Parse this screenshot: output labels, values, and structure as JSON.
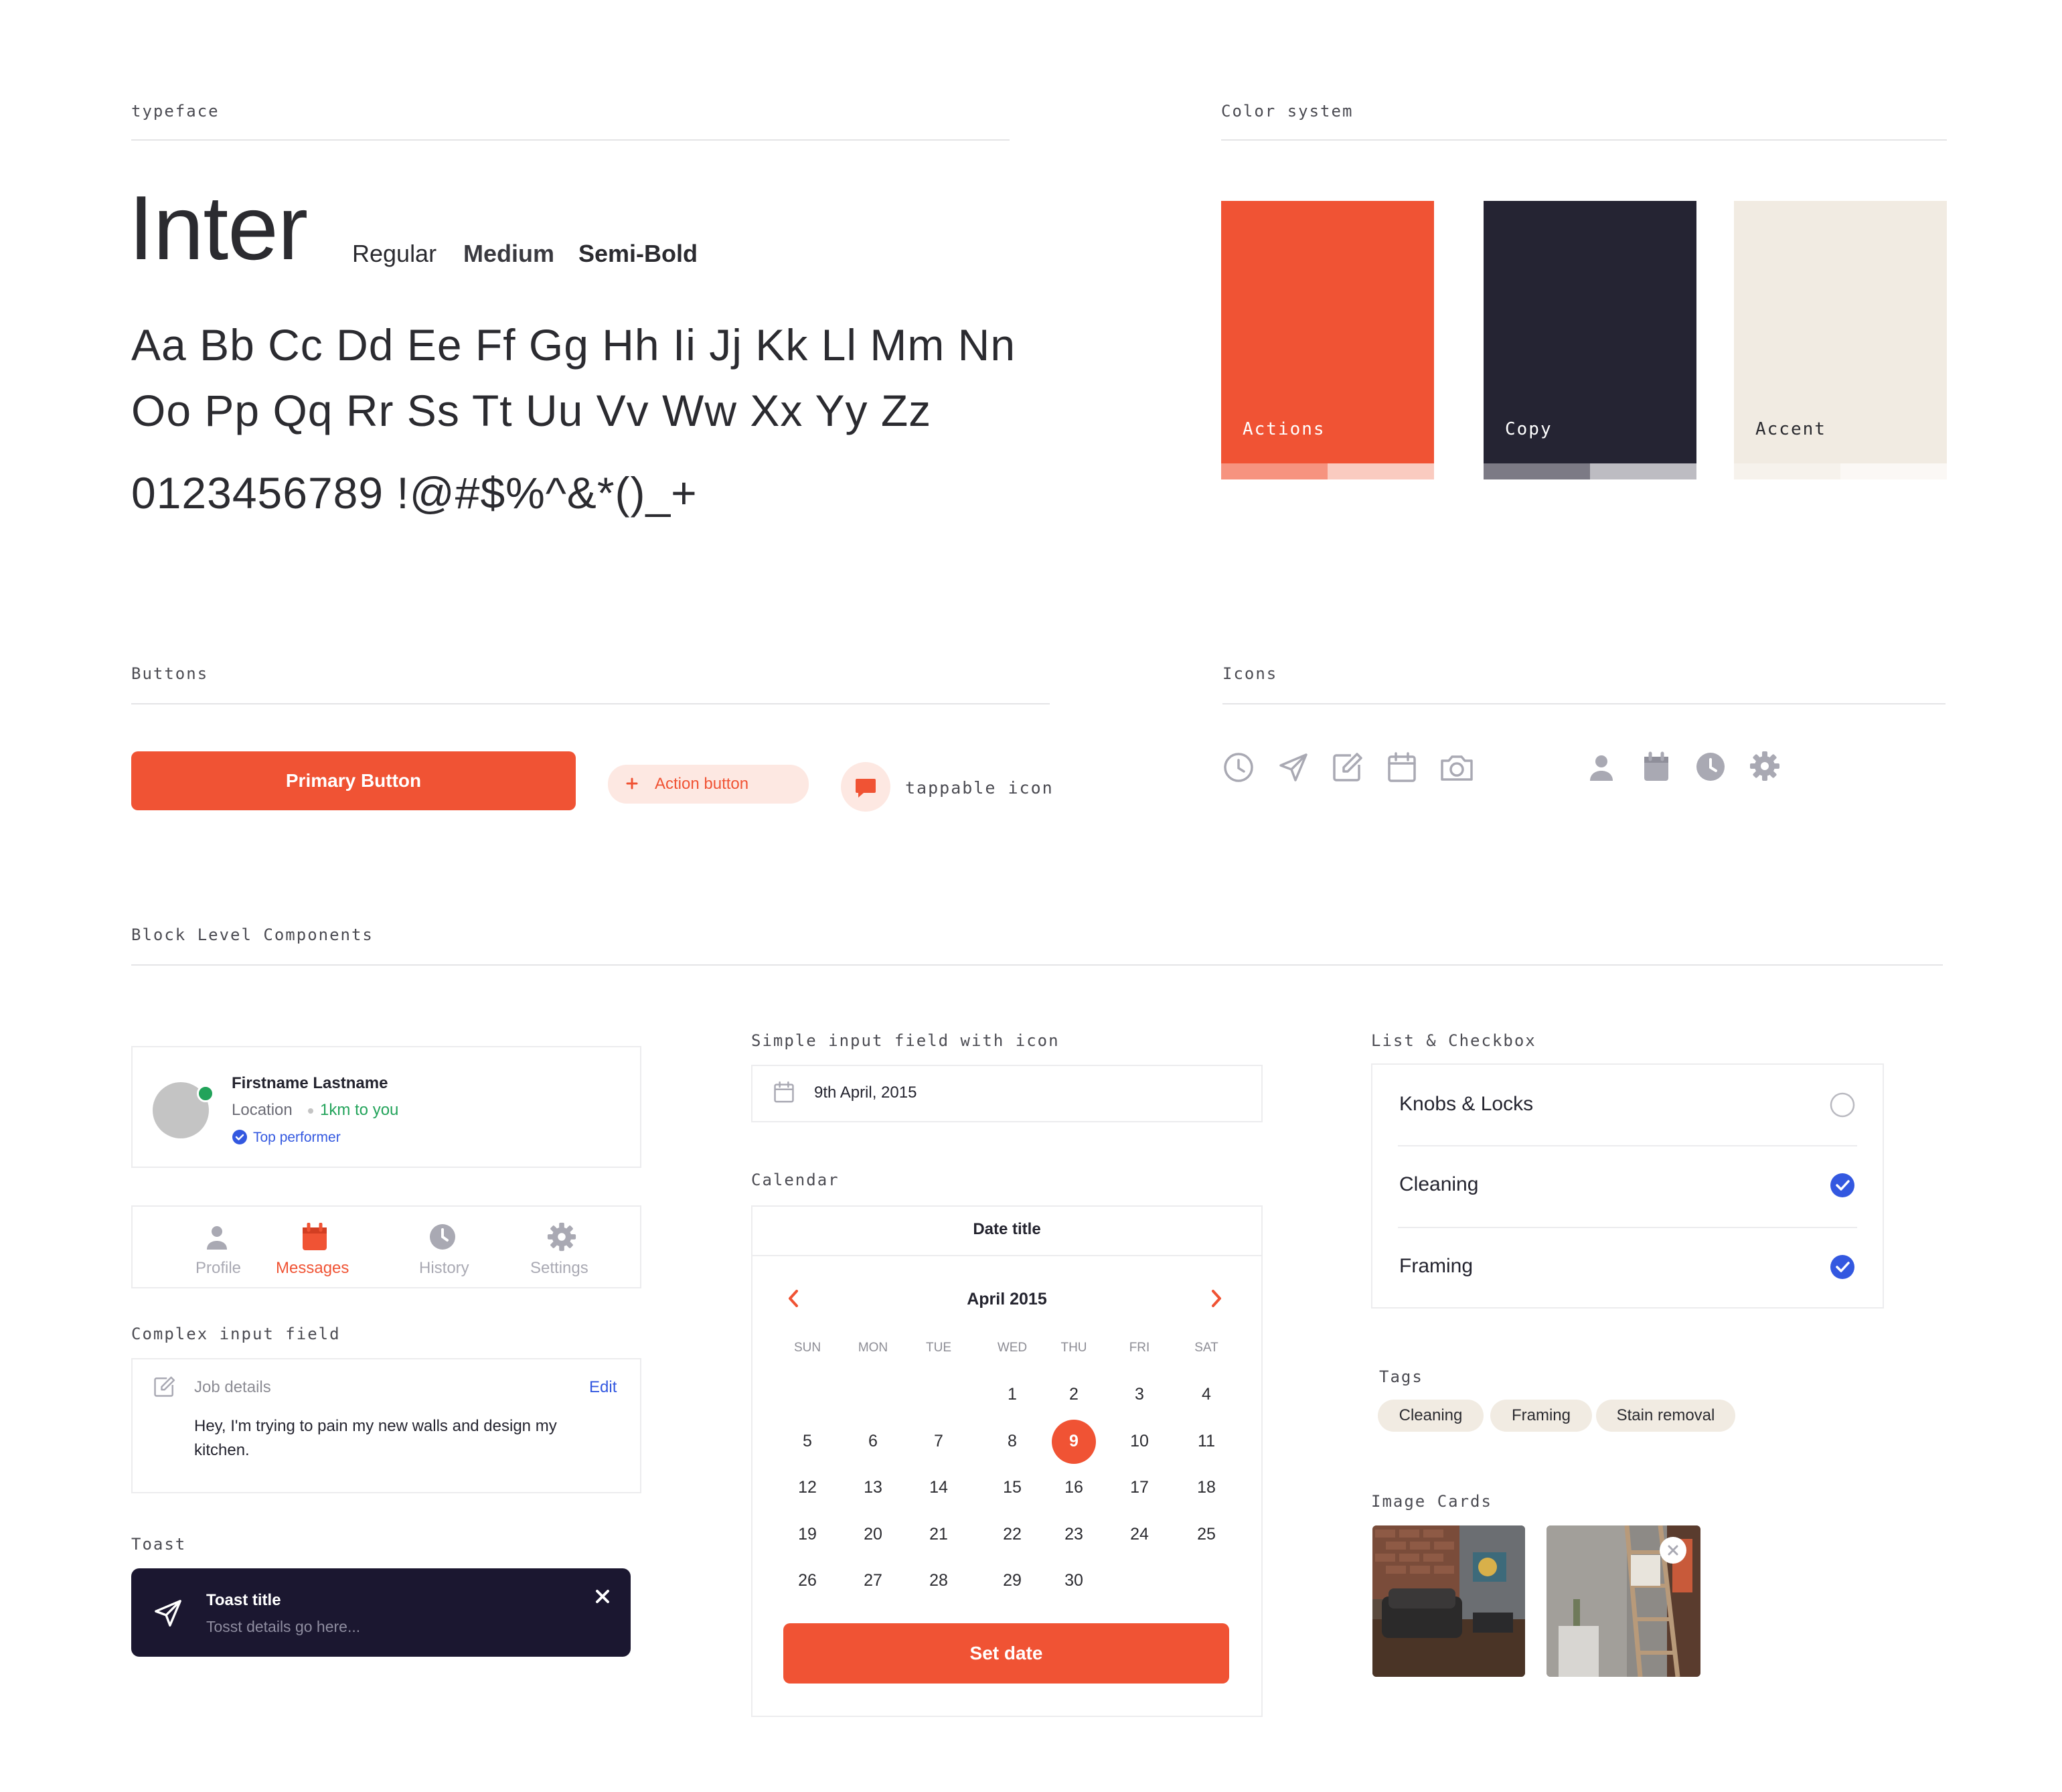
{
  "typeface": {
    "section_label": "typeface",
    "family": "Inter",
    "weights": [
      "Regular",
      "Medium",
      "Semi-Bold"
    ],
    "alphabet_line1": "Aa Bb Cc Dd Ee Ff Gg Hh Ii Jj Kk Ll Mm Nn",
    "alphabet_line2": "Oo Pp Qq Rr Ss Tt Uu Vv Ww Xx Yy Zz",
    "numerals": "0123456789 !@#$%^&*()_+"
  },
  "colors": {
    "section_label": "Color system",
    "swatches": [
      {
        "label": "Actions",
        "color": "#f05334",
        "tint1": "#f6937f",
        "tint2": "#facbc0"
      },
      {
        "label": "Copy",
        "color": "#252433",
        "tint1": "#7c7a85",
        "tint2": "#bdbcc2"
      },
      {
        "label": "Accent",
        "color": "#f1ebe2",
        "tint1": "#f6f2ec",
        "tint2": "#fbf8f5"
      }
    ]
  },
  "buttons": {
    "section_label": "Buttons",
    "primary_label": "Primary Button",
    "action_label": "Action button",
    "action_icon": "plus-icon",
    "tappable_label": "tappable icon",
    "tappable_icon": "chat-bubble-icon"
  },
  "icons": {
    "section_label": "Icons",
    "outline": [
      "clock-icon",
      "send-icon",
      "edit-icon",
      "calendar-icon",
      "camera-icon"
    ],
    "filled": [
      "user-icon",
      "calendar-filled-icon",
      "clock-filled-icon",
      "gear-icon"
    ]
  },
  "blocks": {
    "section_label": "Block Level Components",
    "profile": {
      "name": "Firstname Lastname",
      "location": "Location",
      "distance": "1km to you",
      "badge": "Top performer"
    },
    "tabbar": {
      "tabs": [
        {
          "label": "Profile",
          "icon": "user-icon",
          "active": false
        },
        {
          "label": "Messages",
          "icon": "calendar-icon",
          "active": true
        },
        {
          "label": "History",
          "icon": "clock-icon",
          "active": false
        },
        {
          "label": "Settings",
          "icon": "gear-icon",
          "active": false
        }
      ],
      "active_color": "#f05334",
      "inactive_color": "#a9a9b3"
    },
    "complex_input": {
      "label": "Complex input field",
      "title": "Job details",
      "edit": "Edit",
      "body_line1": "Hey, I'm trying to pain my new walls and design my",
      "body_line2": "kitchen."
    },
    "toast": {
      "label": "Toast",
      "title": "Toast title",
      "details": "Tosst details go here..."
    },
    "simple_input": {
      "label": "Simple input field with icon",
      "value": "9th April, 2015"
    },
    "calendar": {
      "label": "Calendar",
      "header": "Date title",
      "month": "April 2015",
      "weekdays": [
        "SUN",
        "MON",
        "TUE",
        "WED",
        "THU",
        "FRI",
        "SAT"
      ],
      "weeks": [
        [
          "",
          "",
          "",
          "1",
          "2",
          "3",
          "4"
        ],
        [
          "5",
          "6",
          "7",
          "8",
          "9",
          "10",
          "11"
        ],
        [
          "12",
          "13",
          "14",
          "15",
          "16",
          "17",
          "18"
        ],
        [
          "19",
          "20",
          "21",
          "22",
          "23",
          "24",
          "25"
        ],
        [
          "26",
          "27",
          "28",
          "29",
          "30",
          "",
          ""
        ]
      ],
      "selected": "9",
      "button": "Set date"
    },
    "list": {
      "label": "List & Checkbox",
      "items": [
        {
          "text": "Knobs & Locks",
          "checked": false
        },
        {
          "text": "Cleaning",
          "checked": true
        },
        {
          "text": "Framing",
          "checked": true
        }
      ]
    },
    "tags": {
      "label": "Tags",
      "items": [
        "Cleaning",
        "Framing",
        "Stain removal"
      ]
    },
    "image_cards": {
      "label": "Image Cards",
      "close_icon": "close-icon"
    }
  }
}
